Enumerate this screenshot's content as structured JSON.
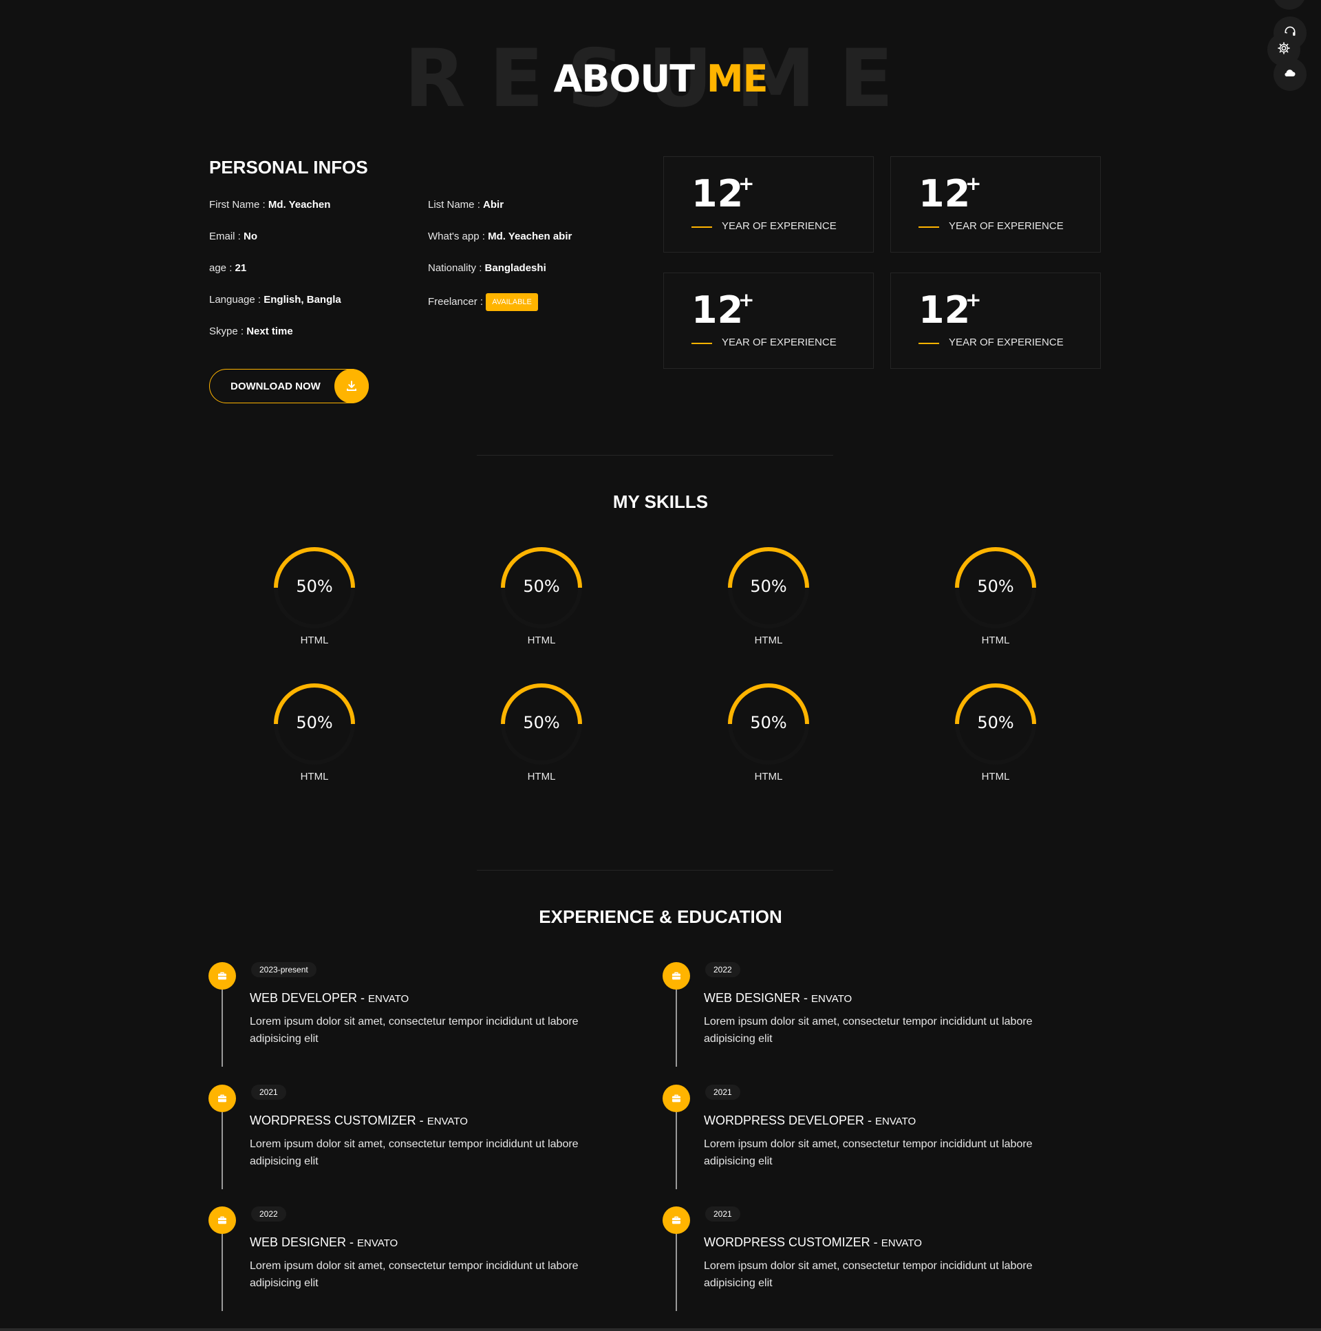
{
  "colors": {
    "background": "#111111",
    "accent": "#ffb400",
    "text": "#ffffff"
  },
  "side_controls": [
    {
      "icon": "headset-icon"
    },
    {
      "icon": "gear-icon"
    },
    {
      "icon": "cloud-icon"
    }
  ],
  "hero": {
    "background_text": "RESUME",
    "title_main": "ABOUT",
    "title_accent": "ME"
  },
  "personal": {
    "heading": "PERSONAL INFOS",
    "fields": [
      {
        "label": "First Name : ",
        "value": "Md. Yeachen"
      },
      {
        "label": "List Name : ",
        "value": "Abir"
      },
      {
        "label": "Email : ",
        "value": "No"
      },
      {
        "label": "What's app : ",
        "value": "Md. Yeachen abir"
      },
      {
        "label": "age : ",
        "value": "21"
      },
      {
        "label": "Nationality : ",
        "value": "Bangladeshi"
      },
      {
        "label": "Language : ",
        "value": "English, Bangla"
      },
      {
        "label": "Freelancer : ",
        "badge": "AVAILABLE"
      },
      {
        "label": "Skype : ",
        "value": "Next time"
      }
    ],
    "download_label": "DOWNLOAD NOW",
    "download_icon": "download-icon"
  },
  "stats": [
    {
      "number": "12",
      "suffix": "+",
      "label": "YEAR OF EXPERIENCE"
    },
    {
      "number": "12",
      "suffix": "+",
      "label": "YEAR OF EXPERIENCE"
    },
    {
      "number": "12",
      "suffix": "+",
      "label": "YEAR OF EXPERIENCE"
    },
    {
      "number": "12",
      "suffix": "+",
      "label": "YEAR OF EXPERIENCE"
    }
  ],
  "skills": {
    "heading": "MY SKILLS",
    "items": [
      {
        "percent": 50,
        "percent_text": "50%",
        "name": "HTML"
      },
      {
        "percent": 50,
        "percent_text": "50%",
        "name": "HTML"
      },
      {
        "percent": 50,
        "percent_text": "50%",
        "name": "HTML"
      },
      {
        "percent": 50,
        "percent_text": "50%",
        "name": "HTML"
      },
      {
        "percent": 50,
        "percent_text": "50%",
        "name": "HTML"
      },
      {
        "percent": 50,
        "percent_text": "50%",
        "name": "HTML"
      },
      {
        "percent": 50,
        "percent_text": "50%",
        "name": "HTML"
      },
      {
        "percent": 50,
        "percent_text": "50%",
        "name": "HTML"
      }
    ]
  },
  "timeline": {
    "heading": "EXPERIENCE & EDUCATION",
    "icon": "briefcase-icon",
    "items": [
      {
        "date": "2023-present",
        "role": "WEB DEVELOPER - ",
        "company": "ENVATO",
        "desc": "Lorem ipsum dolor sit amet, consectetur tempor incididunt ut labore adipisicing elit"
      },
      {
        "date": "2022",
        "role": "WEB DESIGNER - ",
        "company": "ENVATO",
        "desc": "Lorem ipsum dolor sit amet, consectetur tempor incididunt ut labore adipisicing elit"
      },
      {
        "date": "2021",
        "role": "WORDPRESS CUSTOMIZER - ",
        "company": "ENVATO",
        "desc": "Lorem ipsum dolor sit amet, consectetur tempor incididunt ut labore adipisicing elit"
      },
      {
        "date": "2021",
        "role": "WORDPRESS DEVELOPER - ",
        "company": "ENVATO",
        "desc": "Lorem ipsum dolor sit amet, consectetur tempor incididunt ut labore adipisicing elit"
      },
      {
        "date": "2022",
        "role": "WEB DESIGNER - ",
        "company": "ENVATO",
        "desc": "Lorem ipsum dolor sit amet, consectetur tempor incididunt ut labore adipisicing elit"
      },
      {
        "date": "2021",
        "role": "WORDPRESS CUSTOMIZER - ",
        "company": "ENVATO",
        "desc": "Lorem ipsum dolor sit amet, consectetur tempor incididunt ut labore adipisicing elit"
      }
    ]
  }
}
